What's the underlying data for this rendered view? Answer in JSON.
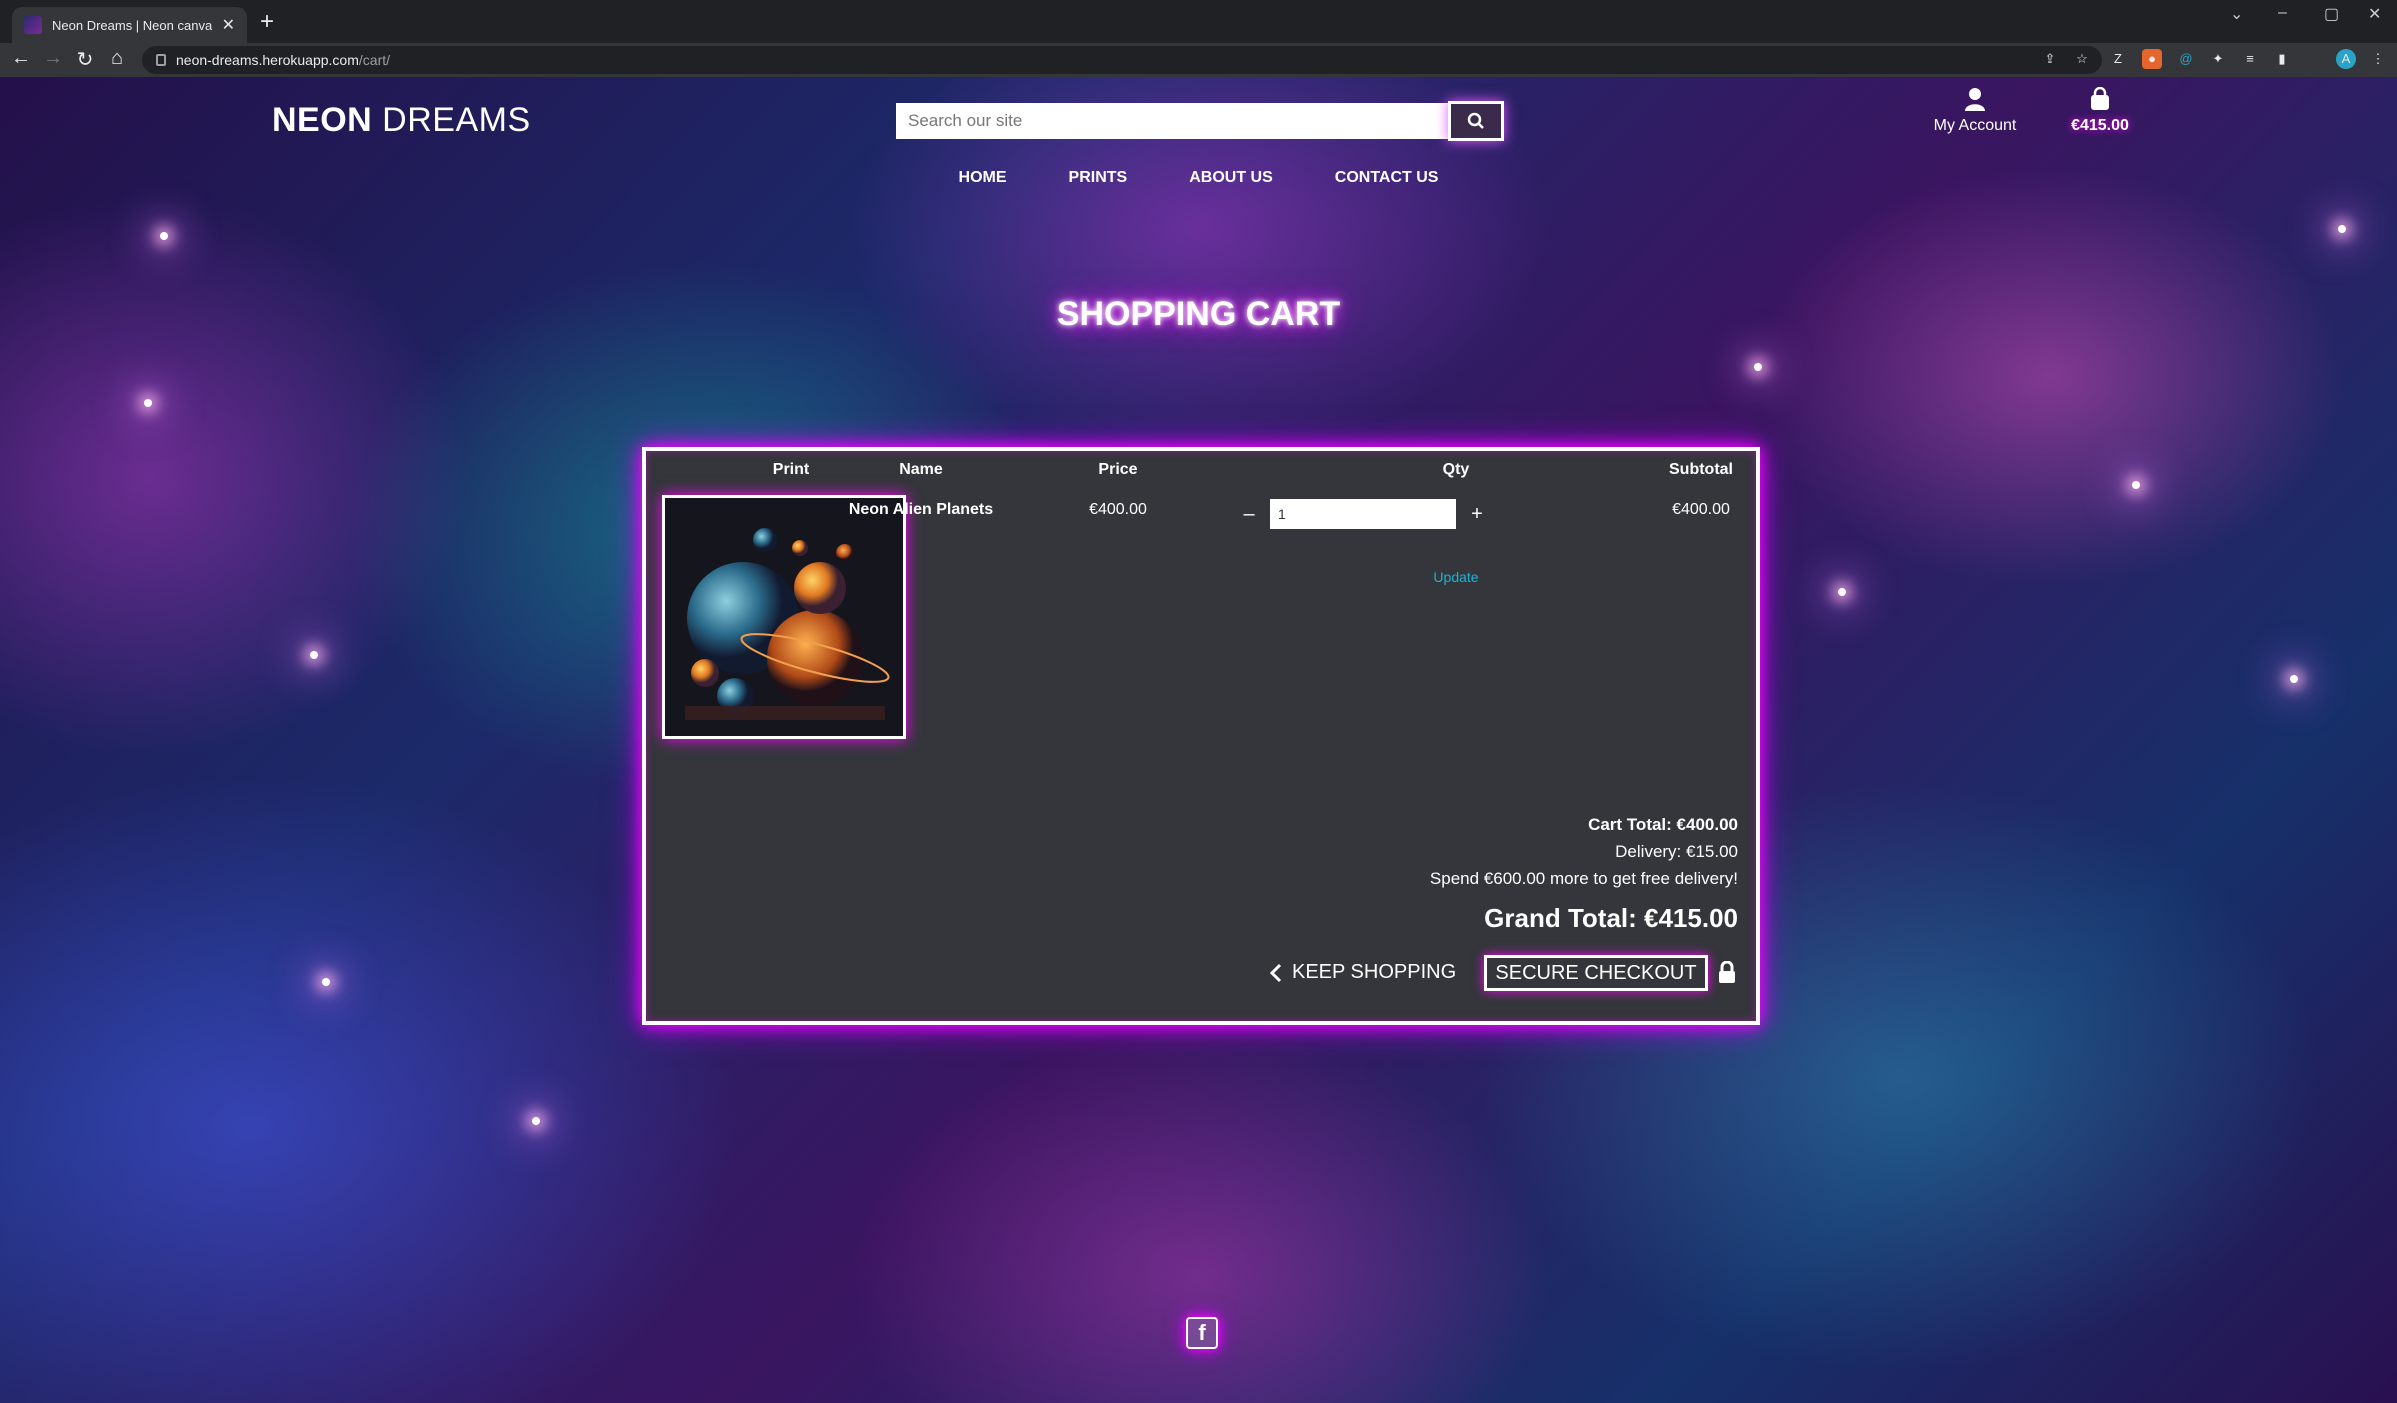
{
  "browser": {
    "tab_title": "Neon Dreams | Neon canvas pri",
    "url_host": "neon-dreams.herokuapp.com",
    "url_path": "/cart/",
    "avatar_letter": "A"
  },
  "site": {
    "logo_bold": "NEON",
    "logo_light": " DREAMS",
    "search_placeholder": "Search our site",
    "account_label": "My Account",
    "bag_total": "€415.00",
    "nav": [
      "HOME",
      "PRINTS",
      "ABOUT US",
      "CONTACT US"
    ]
  },
  "cart": {
    "heading": "SHOPPING CART",
    "columns": {
      "print": "Print",
      "name": "Name",
      "price": "Price",
      "qty": "Qty",
      "subtotal": "Subtotal"
    },
    "item": {
      "name": "Neon Alien Planets",
      "price": "€400.00",
      "qty": "1",
      "subtotal": "€400.00"
    },
    "update_label": "Update",
    "minus": "–",
    "plus": "+",
    "cart_total": "Cart Total: €400.00",
    "delivery": "Delivery: €15.00",
    "free_delivery_note": "Spend €600.00 more to get free delivery!",
    "grand_total": "Grand Total: €415.00",
    "keep_shopping": "KEEP SHOPPING",
    "checkout": "SECURE CHECKOUT"
  },
  "footer": {
    "facebook_glyph": "f"
  },
  "colors": {
    "neon_pink": "#ff00ff",
    "link_cyan": "#18b6d6",
    "panel": "#34363b"
  }
}
